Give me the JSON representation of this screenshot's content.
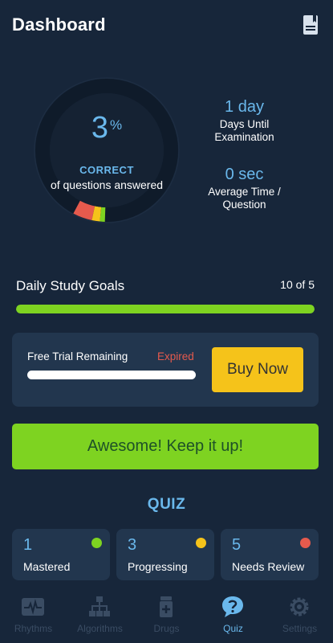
{
  "header": {
    "title": "Dashboard",
    "icon": "book-icon"
  },
  "progress": {
    "percent": "3",
    "percent_sign": "%",
    "correct_label": "CORRECT",
    "description": "of questions answered"
  },
  "stats": [
    {
      "value": "1 day",
      "label": "Days Until Examination"
    },
    {
      "value": "0 sec",
      "label": "Average Time / Question"
    }
  ],
  "goals": {
    "title": "Daily Study Goals",
    "count": "10 of 5",
    "fill_percent": 100
  },
  "trial": {
    "label": "Free Trial Remaining",
    "status": "Expired",
    "buy_label": "Buy Now",
    "remaining_fraction": 0
  },
  "encouragement": {
    "label": "Awesome! Keep it up!"
  },
  "quiz": {
    "title": "QUIZ",
    "cards": [
      {
        "count": "1",
        "label": "Mastered",
        "color": "#7ed321"
      },
      {
        "count": "3",
        "label": "Progressing",
        "color": "#f5c31a"
      },
      {
        "count": "5",
        "label": "Needs Review",
        "color": "#e55a4d"
      }
    ]
  },
  "nav": {
    "items": [
      {
        "label": "Rhythms",
        "icon": "ecg-icon"
      },
      {
        "label": "Algorithms",
        "icon": "flowchart-icon"
      },
      {
        "label": "Drugs",
        "icon": "pill-bottle-icon"
      },
      {
        "label": "Quiz",
        "icon": "question-bubble-icon"
      },
      {
        "label": "Settings",
        "icon": "gear-icon"
      }
    ],
    "active": "Quiz"
  },
  "colors": {
    "accent": "#6ab8ec",
    "success": "#7ed321",
    "warning": "#f5c31a",
    "danger": "#e55a4d",
    "background": "#17263a",
    "card": "#22364e"
  }
}
